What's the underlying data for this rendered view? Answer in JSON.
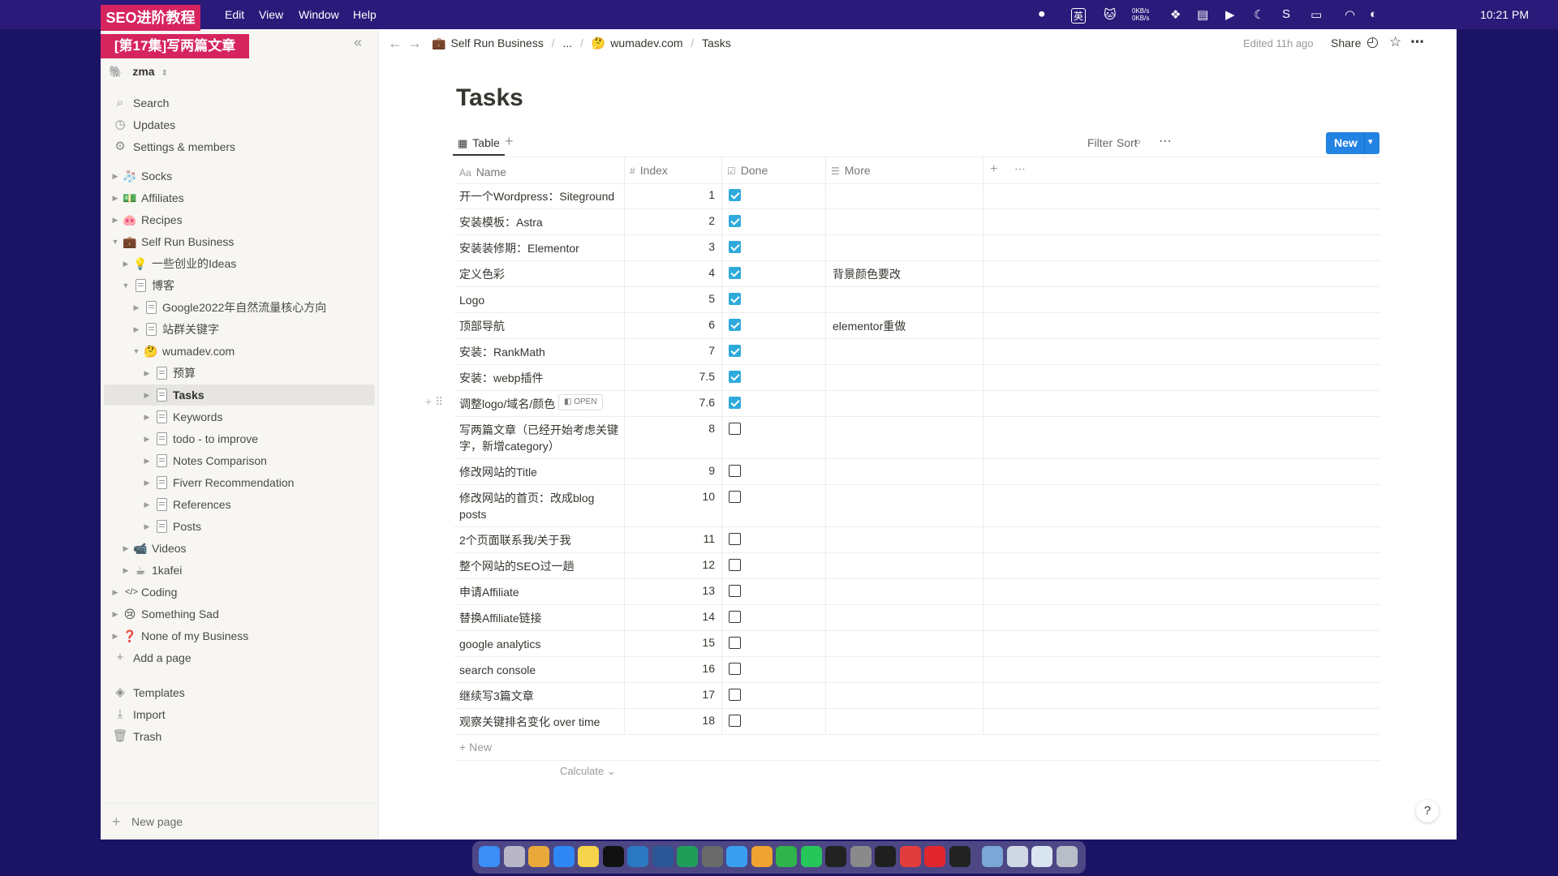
{
  "overlay": {
    "seo_banner": "SEO进阶教程",
    "episode_banner": "[第17集]写两篇文章"
  },
  "menubar": {
    "items": [
      "Edit",
      "View",
      "Window",
      "Help"
    ],
    "clock": "10:21 PM",
    "input_badge": "英",
    "net_up": "0KB/s",
    "net_down": "0KB/s"
  },
  "sidebar": {
    "workspace": "zma",
    "top_items": [
      {
        "label": "Search",
        "icon": "search-icon"
      },
      {
        "label": "Updates",
        "icon": "clock-icon"
      },
      {
        "label": "Settings & members",
        "icon": "gear-icon"
      }
    ],
    "tree": [
      {
        "label": "Socks",
        "emoji": "🧦",
        "depth": 0,
        "arrow": "▶"
      },
      {
        "label": "Affiliates",
        "emoji": "💵",
        "depth": 0,
        "arrow": "▶"
      },
      {
        "label": "Recipes",
        "emoji": "🐽",
        "depth": 0,
        "arrow": "▶"
      },
      {
        "label": "Self Run Business",
        "emoji": "💼",
        "depth": 0,
        "arrow": "▼"
      },
      {
        "label": "一些创业的Ideas",
        "emoji": "💡",
        "depth": 1,
        "arrow": "▶"
      },
      {
        "label": "博客",
        "emoji": "",
        "depth": 1,
        "arrow": "▼"
      },
      {
        "label": "Google2022年自然流量核心方向",
        "emoji": "",
        "depth": 2,
        "arrow": "▶"
      },
      {
        "label": "站群关键字",
        "emoji": "",
        "depth": 2,
        "arrow": "▶"
      },
      {
        "label": "wumadev.com",
        "emoji": "🤔",
        "depth": 2,
        "arrow": "▼"
      },
      {
        "label": "预算",
        "emoji": "",
        "depth": 3,
        "arrow": "▶"
      },
      {
        "label": "Tasks",
        "emoji": "",
        "depth": 3,
        "arrow": "▶",
        "active": true
      },
      {
        "label": "Keywords",
        "emoji": "",
        "depth": 3,
        "arrow": "▶"
      },
      {
        "label": "todo - to improve",
        "emoji": "",
        "depth": 3,
        "arrow": "▶"
      },
      {
        "label": "Notes Comparison",
        "emoji": "",
        "depth": 3,
        "arrow": "▶"
      },
      {
        "label": "Fiverr Recommendation",
        "emoji": "",
        "depth": 3,
        "arrow": "▶"
      },
      {
        "label": "References",
        "emoji": "",
        "depth": 3,
        "arrow": "▶"
      },
      {
        "label": "Posts",
        "emoji": "",
        "depth": 3,
        "arrow": "▶"
      },
      {
        "label": "Videos",
        "emoji": "📹",
        "depth": 1,
        "arrow": "▶"
      },
      {
        "label": "1kafei",
        "emoji": "☕",
        "depth": 1,
        "arrow": "▶"
      },
      {
        "label": "Coding",
        "emoji": "</>",
        "depth": 0,
        "arrow": "▶"
      },
      {
        "label": "Something Sad",
        "emoji": "😢",
        "depth": 0,
        "arrow": "▶"
      },
      {
        "label": "None of my Business",
        "emoji": "❓",
        "depth": 0,
        "arrow": "▶"
      }
    ],
    "add_page": "Add a page",
    "bottom_items": [
      {
        "label": "Templates",
        "icon": "templates-icon"
      },
      {
        "label": "Import",
        "icon": "import-icon"
      },
      {
        "label": "Trash",
        "icon": "trash-icon"
      }
    ],
    "new_page": "New page"
  },
  "topbar": {
    "breadcrumb": [
      "Self Run Business",
      "...",
      "wumadev.com",
      "Tasks"
    ],
    "edited": "Edited 11h ago",
    "share": "Share"
  },
  "page": {
    "title": "Tasks",
    "view_tab": "Table",
    "filter": "Filter",
    "sort": "Sort",
    "new_button": "New",
    "columns": [
      "Name",
      "Index",
      "Done",
      "More"
    ],
    "open_badge": "OPEN",
    "rows": [
      {
        "name": "开一个Wordpress：Siteground",
        "index": "1",
        "done": true,
        "more": ""
      },
      {
        "name": "安装模板：Astra",
        "index": "2",
        "done": true,
        "more": ""
      },
      {
        "name": "安装装修期：Elementor",
        "index": "3",
        "done": true,
        "more": ""
      },
      {
        "name": "定义色彩",
        "index": "4",
        "done": true,
        "more": "背景颜色要改"
      },
      {
        "name": "Logo",
        "index": "5",
        "done": true,
        "more": ""
      },
      {
        "name": "顶部导航",
        "index": "6",
        "done": true,
        "more": "elementor重做"
      },
      {
        "name": "安装：RankMath",
        "index": "7",
        "done": true,
        "more": ""
      },
      {
        "name": "安装：webp插件",
        "index": "7.5",
        "done": true,
        "more": ""
      },
      {
        "name": "调整logo/域名/颜色",
        "index": "7.6",
        "done": true,
        "more": "",
        "hover": true
      },
      {
        "name": "写两篇文章（已经开始考虑关键字，新增category）",
        "index": "8",
        "done": false,
        "more": "",
        "tall": true
      },
      {
        "name": "修改网站的Title",
        "index": "9",
        "done": false,
        "more": ""
      },
      {
        "name": "修改网站的首页：改成blog posts",
        "index": "10",
        "done": false,
        "more": "",
        "tall": true
      },
      {
        "name": "2个页面联系我/关于我",
        "index": "11",
        "done": false,
        "more": ""
      },
      {
        "name": "整个网站的SEO过一趟",
        "index": "12",
        "done": false,
        "more": ""
      },
      {
        "name": "申请Affiliate",
        "index": "13",
        "done": false,
        "more": ""
      },
      {
        "name": "替换Affiliate链接",
        "index": "14",
        "done": false,
        "more": ""
      },
      {
        "name": "google analytics",
        "index": "15",
        "done": false,
        "more": ""
      },
      {
        "name": "search console",
        "index": "16",
        "done": false,
        "more": ""
      },
      {
        "name": "继续写3篇文章",
        "index": "17",
        "done": false,
        "more": ""
      },
      {
        "name": "观察关键排名变化 over time",
        "index": "18",
        "done": false,
        "more": ""
      }
    ],
    "add_row": "New",
    "calculate": "Calculate"
  },
  "help": "?",
  "dock_apps": [
    "finder",
    "launchpad",
    "chrome",
    "safari",
    "notes",
    "notion",
    "vscode",
    "word",
    "pycharm",
    "chatgpt",
    "xcode",
    "keynote",
    "numbers",
    "wechat",
    "terminal",
    "settings",
    "github",
    "xmind",
    "opera",
    "iterm",
    "preview",
    "files",
    "finder-window",
    "trash"
  ]
}
